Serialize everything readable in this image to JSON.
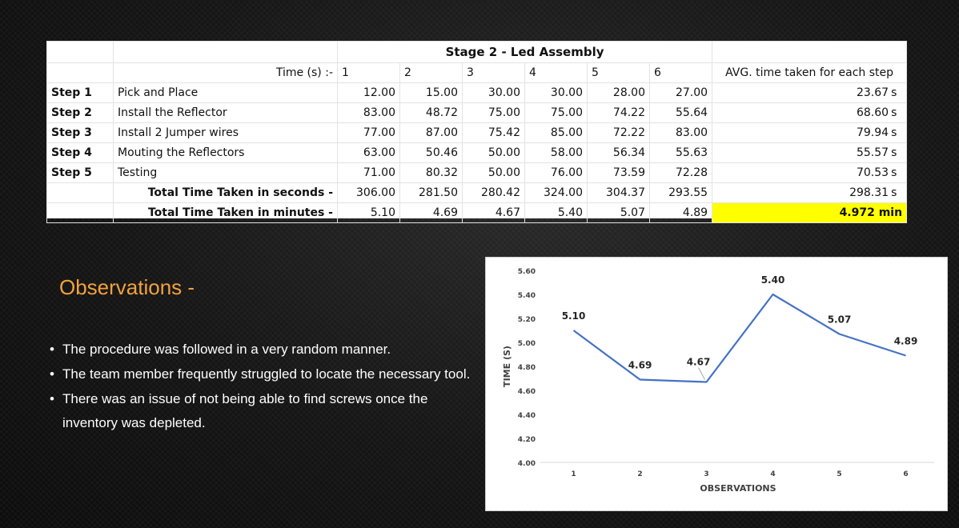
{
  "table": {
    "title": "Stage 2 - Led Assembly",
    "time_label": "Time (s) :-",
    "columns": [
      "1",
      "2",
      "3",
      "4",
      "5",
      "6"
    ],
    "avg_header": "AVG. time taken for each step",
    "unit": "s",
    "rows": [
      {
        "step": "Step 1",
        "task": "Pick and Place",
        "values": [
          "12.00",
          "15.00",
          "30.00",
          "30.00",
          "28.00",
          "27.00"
        ],
        "avg": "23.67"
      },
      {
        "step": "Step 2",
        "task": "Install the Reflector",
        "values": [
          "83.00",
          "48.72",
          "75.00",
          "75.00",
          "74.22",
          "55.64"
        ],
        "avg": "68.60"
      },
      {
        "step": "Step 3",
        "task": "Install 2 Jumper wires",
        "values": [
          "77.00",
          "87.00",
          "75.42",
          "85.00",
          "72.22",
          "83.00"
        ],
        "avg": "79.94"
      },
      {
        "step": "Step 4",
        "task": "Mouting the Reflectors",
        "values": [
          "63.00",
          "50.46",
          "50.00",
          "58.00",
          "56.34",
          "55.63"
        ],
        "avg": "55.57"
      },
      {
        "step": "Step 5",
        "task": "Testing",
        "values": [
          "71.00",
          "80.32",
          "50.00",
          "76.00",
          "73.59",
          "72.28"
        ],
        "avg": "70.53"
      }
    ],
    "total_seconds": {
      "label": "Total Time Taken in seconds -",
      "values": [
        "306.00",
        "281.50",
        "280.42",
        "324.00",
        "304.37",
        "293.55"
      ],
      "avg": "298.31"
    },
    "total_minutes": {
      "label": "Total Time Taken in minutes  -",
      "values": [
        "5.10",
        "4.69",
        "4.67",
        "5.40",
        "5.07",
        "4.89"
      ],
      "avg": "4.972 min"
    },
    "highlight_color": "#ffff00"
  },
  "observations": {
    "title": "Observations  -",
    "title_color": "#f2a23c",
    "items": [
      "The procedure was followed in a very random manner.",
      "The team member frequently struggled to locate the necessary tool.",
      "There was an issue of not being able to find screws once the inventory was depleted."
    ]
  },
  "chart_data": {
    "type": "line",
    "x": [
      1,
      2,
      3,
      4,
      5,
      6
    ],
    "categories": [
      "1",
      "2",
      "3",
      "4",
      "5",
      "6"
    ],
    "series": [
      {
        "values": [
          5.1,
          4.69,
          4.67,
          5.4,
          5.07,
          4.89
        ]
      }
    ],
    "data_labels": [
      "5.10",
      "4.69",
      "4.67",
      "5.40",
      "5.07",
      "4.89"
    ],
    "xlabel": "OBSERVATIONS",
    "ylabel": "TIME (S)",
    "ylim": [
      4.0,
      5.6
    ],
    "yticks": [
      "4.00",
      "4.20",
      "4.40",
      "4.60",
      "4.80",
      "5.00",
      "5.20",
      "5.40",
      "5.60"
    ],
    "grid": false,
    "line_color": "#4472c4"
  }
}
